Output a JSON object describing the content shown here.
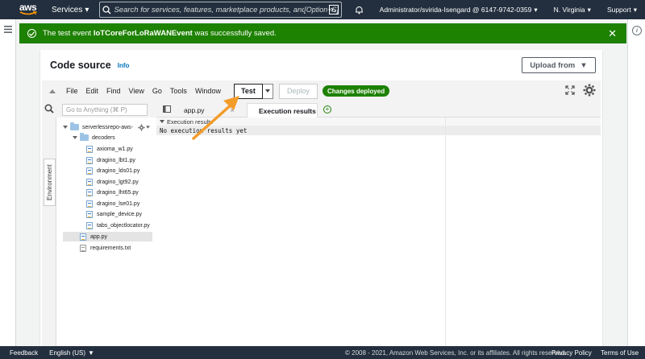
{
  "topnav": {
    "logo": "aws",
    "services_label": "Services",
    "search_placeholder": "Search for services, features, marketplace products, and doc",
    "search_shortcut": "[Option+S]",
    "account": "Administrator/svirida-Isengard @ 6147-9742-0359",
    "region": "N. Virginia",
    "support": "Support"
  },
  "flash": {
    "prefix": "The test event ",
    "event_name": "IoTCoreForLoRaWANEvent",
    "suffix": " was successfully saved.",
    "color": "#1d8102"
  },
  "code_source": {
    "title": "Code source",
    "info_link": "Info",
    "upload_label": "Upload from"
  },
  "toolbar": {
    "menus": [
      "File",
      "Edit",
      "Find",
      "View",
      "Go",
      "Tools",
      "Window"
    ],
    "test_label": "Test",
    "deploy_label": "Deploy",
    "status_badge": "Changes deployed"
  },
  "environment": {
    "tab_label": "Environment",
    "goto_placeholder": "Go to Anything (⌘ P)",
    "root_folder": "serverlessrepo-aws-",
    "subfolder": "decoders",
    "decoder_files": [
      "axioma_w1.py",
      "dragino_lbt1.py",
      "dragino_lds01.py",
      "dragino_lgt92.py",
      "dragino_lht65.py",
      "dragino_lse01.py",
      "sample_device.py",
      "tabs_objectlocator.py"
    ],
    "root_files": [
      "app.py",
      "requirements.txt"
    ],
    "selected_file": "app.py"
  },
  "editor": {
    "tabs": [
      {
        "label": "app.py",
        "active": false
      },
      {
        "label": "Execution results",
        "active": true
      }
    ],
    "results_header": "Execution results",
    "results_text": "No execution results yet"
  },
  "footer": {
    "feedback": "Feedback",
    "language": "English (US)",
    "copyright": "© 2008 - 2021, Amazon Web Services, Inc. or its affiliates. All rights reserved.",
    "privacy": "Privacy Policy",
    "terms": "Terms of Use"
  }
}
